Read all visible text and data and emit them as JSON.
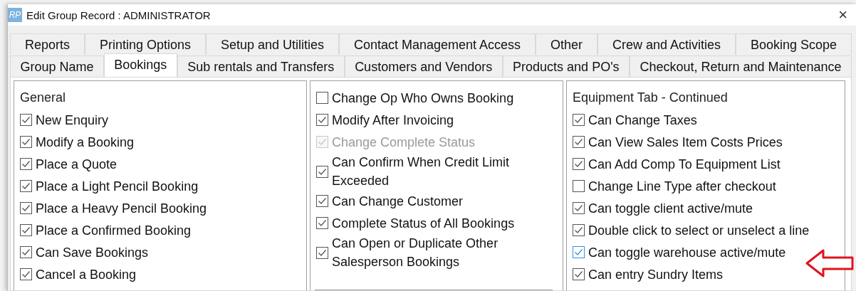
{
  "window": {
    "logo": "RP",
    "title": "Edit Group Record : ADMINISTRATOR",
    "close": "×"
  },
  "tab_rows": [
    {
      "tabs": [
        {
          "label": "Reports",
          "selected": false
        },
        {
          "label": "Printing Options",
          "selected": false
        },
        {
          "label": "Setup and Utilities",
          "selected": false
        },
        {
          "label": "Contact Management Access",
          "selected": false
        },
        {
          "label": "Other",
          "selected": false
        },
        {
          "label": "Crew and Activities",
          "selected": false
        },
        {
          "label": "Booking Scope",
          "selected": false
        }
      ]
    },
    {
      "tabs": [
        {
          "label": "Group Name",
          "selected": false
        },
        {
          "label": "Bookings",
          "selected": true
        },
        {
          "label": "Sub rentals and Transfers",
          "selected": false
        },
        {
          "label": "Customers and Vendors",
          "selected": false
        },
        {
          "label": "Products and PO's",
          "selected": false
        },
        {
          "label": "Checkout, Return and Maintenance",
          "selected": false
        }
      ]
    }
  ],
  "columns": [
    {
      "heading": "General",
      "items": [
        {
          "label": "New Enquiry",
          "checked": true,
          "disabled": false,
          "focused": false
        },
        {
          "label": "Modify a Booking",
          "checked": true,
          "disabled": false,
          "focused": false
        },
        {
          "label": "Place a Quote",
          "checked": true,
          "disabled": false,
          "focused": false
        },
        {
          "label": "Place a Light Pencil Booking",
          "checked": true,
          "disabled": false,
          "focused": false
        },
        {
          "label": "Place a Heavy Pencil Booking",
          "checked": true,
          "disabled": false,
          "focused": false
        },
        {
          "label": "Place a Confirmed Booking",
          "checked": true,
          "disabled": false,
          "focused": false
        },
        {
          "label": "Can Save Bookings",
          "checked": true,
          "disabled": false,
          "focused": false
        },
        {
          "label": "Cancel a Booking",
          "checked": true,
          "disabled": false,
          "focused": false
        }
      ]
    },
    {
      "items": [
        {
          "label": "Change Op Who Owns Booking",
          "checked": false,
          "disabled": false,
          "focused": false
        },
        {
          "label": "Modify After Invoicing",
          "checked": true,
          "disabled": false,
          "focused": false
        },
        {
          "label": "Change Complete Status",
          "checked": true,
          "disabled": true,
          "focused": false
        },
        {
          "label": "Can Confirm When Credit Limit Exceeded",
          "checked": true,
          "disabled": false,
          "focused": false
        },
        {
          "label": "Can Change Customer",
          "checked": true,
          "disabled": false,
          "focused": false
        },
        {
          "label": "Complete Status of All Bookings",
          "checked": true,
          "disabled": false,
          "focused": false
        },
        {
          "label": "Can Open or Duplicate Other Salesperson Bookings",
          "checked": true,
          "disabled": false,
          "focused": false
        }
      ]
    },
    {
      "heading": "Equipment Tab - Continued",
      "items": [
        {
          "label": "Can Change Taxes",
          "checked": true,
          "disabled": false,
          "focused": false
        },
        {
          "label": "Can View Sales Item Costs Prices",
          "checked": true,
          "disabled": false,
          "focused": false
        },
        {
          "label": "Can Add Comp To Equipment List",
          "checked": true,
          "disabled": false,
          "focused": false
        },
        {
          "label": "Change Line Type after checkout",
          "checked": false,
          "disabled": false,
          "focused": false
        },
        {
          "label": "Can toggle client active/mute",
          "checked": true,
          "disabled": false,
          "focused": false
        },
        {
          "label": "Double click to select or unselect a line",
          "checked": true,
          "disabled": false,
          "focused": false
        },
        {
          "label": "Can toggle warehouse active/mute",
          "checked": true,
          "disabled": false,
          "focused": true
        },
        {
          "label": "Can entry Sundry Items",
          "checked": true,
          "disabled": false,
          "focused": false
        }
      ]
    }
  ]
}
